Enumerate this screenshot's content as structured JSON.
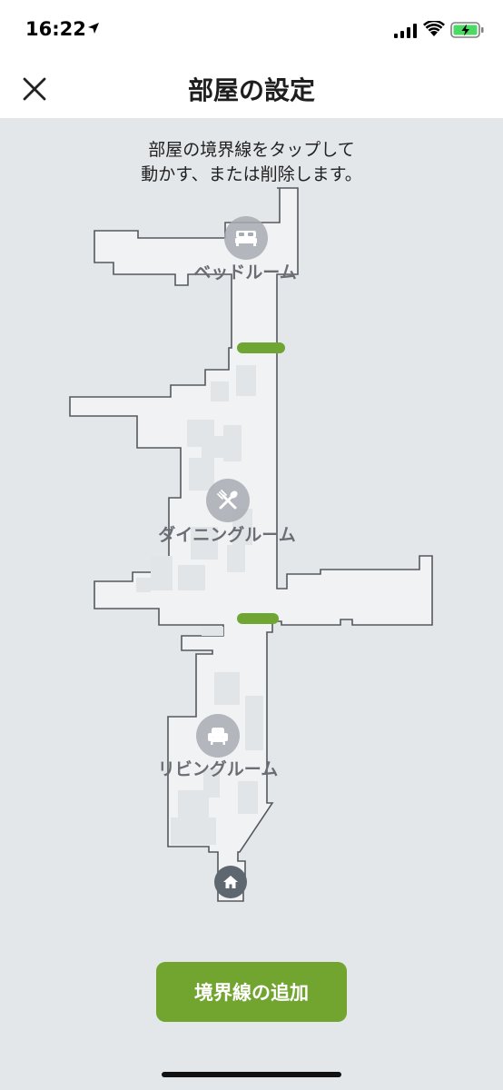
{
  "status_bar": {
    "time": "16:22"
  },
  "header": {
    "title": "部屋の設定"
  },
  "instruction": {
    "line1": "部屋の境界線をタップして",
    "line2": "動かす、または削除します。"
  },
  "rooms": [
    {
      "label": "ベッドルーム",
      "icon": "bed-icon"
    },
    {
      "label": "ダイニングルーム",
      "icon": "dining-icon"
    },
    {
      "label": "リビングルーム",
      "icon": "armchair-icon"
    }
  ],
  "actions": {
    "add_boundary": "境界線の追加"
  },
  "colors": {
    "accent": "#72a530",
    "divider": "#6fa532",
    "map_fill": "#f1f2f4",
    "map_stroke": "#55595e",
    "background": "#e4e7ea"
  }
}
